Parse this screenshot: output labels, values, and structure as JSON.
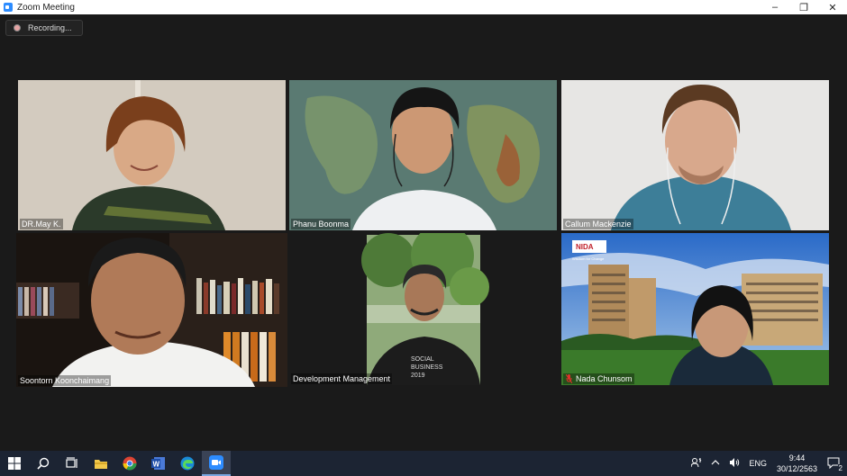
{
  "window": {
    "title": "Zoom Meeting",
    "minimize": "–",
    "restore": "❐",
    "close": "✕"
  },
  "recording": {
    "label": "Recording..."
  },
  "participants": [
    {
      "name": "DR.May K."
    },
    {
      "name": "Phanu Boonma"
    },
    {
      "name": "Callum Mackenzie"
    },
    {
      "name": "Soontorn Koonchaimang",
      "active_speaker": true
    },
    {
      "name": "Development Management"
    },
    {
      "name": "Nada Chunsom",
      "muted": true
    }
  ],
  "backgrounds": {
    "nida_logo": "NIDA",
    "nida_sub": "Wisdom for Change",
    "shirt_text_1": "SOCIAL",
    "shirt_text_2": "BUSINESS",
    "shirt_text_3": "2019"
  },
  "taskbar": {
    "apps": [
      "start-icon",
      "search-icon",
      "task-view-icon",
      "file-explorer-icon",
      "chrome-icon",
      "word-icon",
      "edge-icon",
      "zoom-icon"
    ],
    "word_glyph": "W",
    "tray": {
      "lang": "ENG",
      "time": "9:44",
      "date": "30/12/2563",
      "notifications": "2"
    }
  },
  "colors": {
    "accent_active": "#d7e05a",
    "zoom_blue": "#2d8cff",
    "taskbar_bg": "#1c2433"
  }
}
